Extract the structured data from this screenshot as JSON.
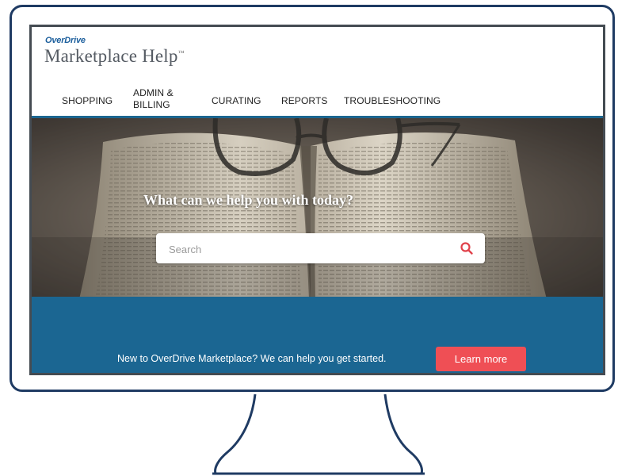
{
  "brand": {
    "name": "OverDrive",
    "product": "Marketplace Help",
    "tm": "™"
  },
  "nav": {
    "items": [
      {
        "label": "SHOPPING"
      },
      {
        "label_line1": "ADMIN &",
        "label_line2": "BILLING"
      },
      {
        "label": "CURATING"
      },
      {
        "label": "REPORTS"
      },
      {
        "label": "TROUBLESHOOTING"
      }
    ]
  },
  "hero": {
    "title": "What can we help you with today?",
    "search": {
      "placeholder": "Search",
      "value": "",
      "icon": "search-icon"
    }
  },
  "banner": {
    "text": "New to OverDrive Marketplace? We can help you get started.",
    "button_label": "Learn more"
  },
  "colors": {
    "monitor_frame": "#1f3b63",
    "brand_blue": "#1b5e9c",
    "banner_blue": "#1b6692",
    "button_red": "#ef4f55",
    "search_icon_red": "#e0414a"
  }
}
